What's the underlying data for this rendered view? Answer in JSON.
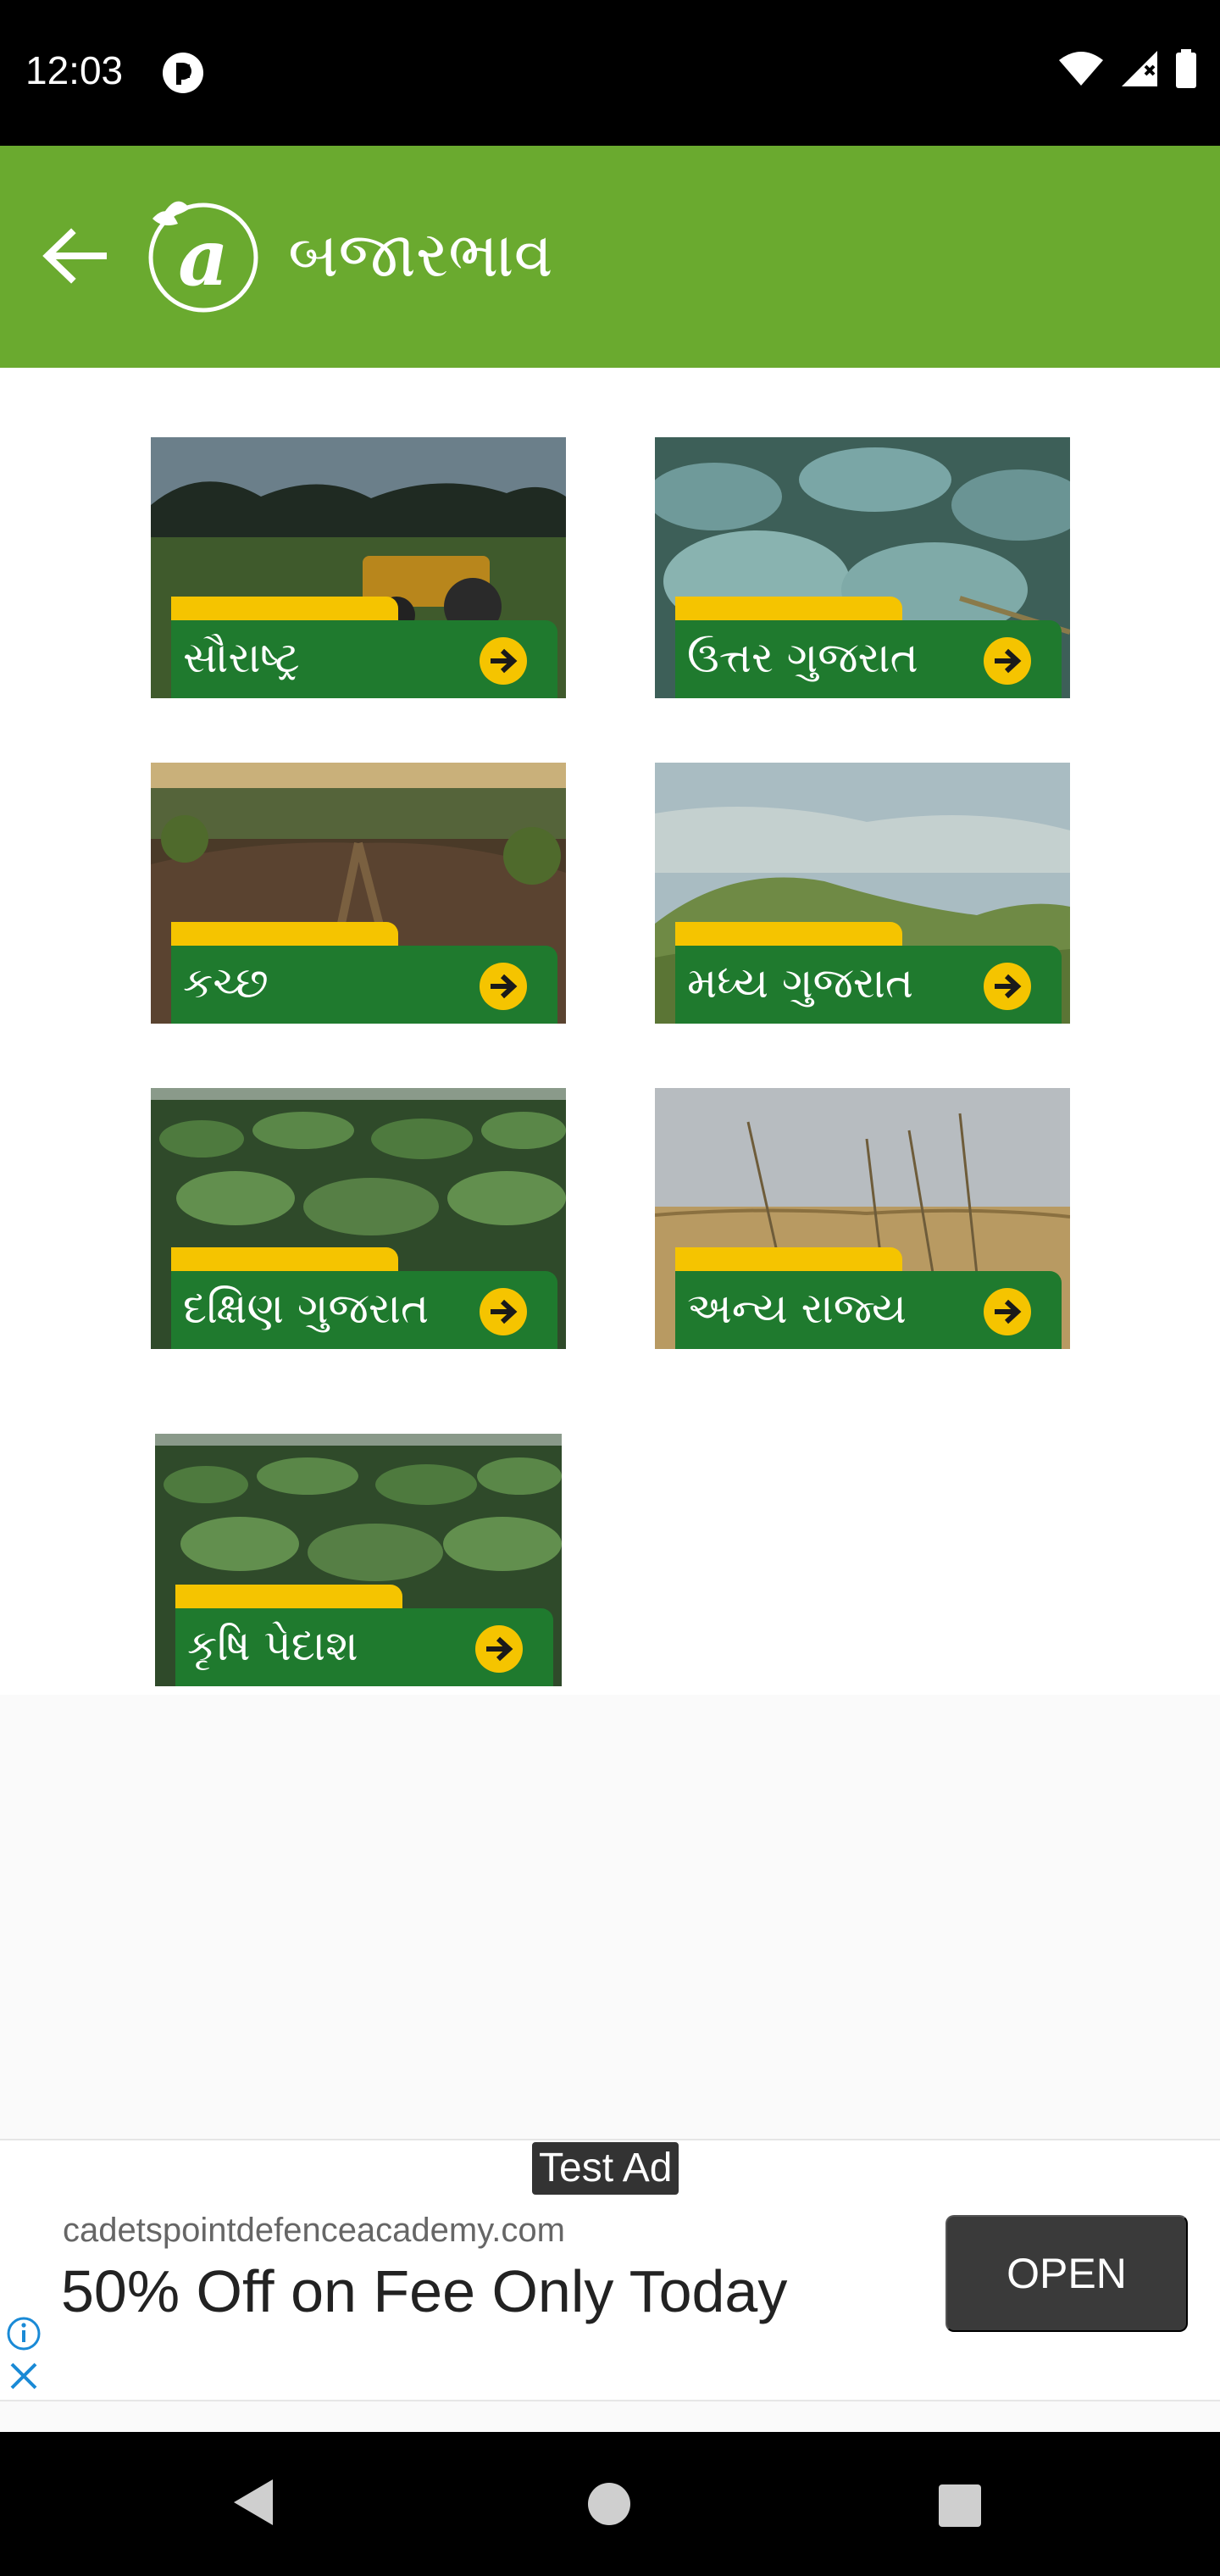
{
  "status_bar": {
    "time": "12:03"
  },
  "app_bar": {
    "title": "બજારભાવ",
    "logo_letter": "a"
  },
  "regions": [
    {
      "label": "સૌરાષ્ટ્ર",
      "photo": "tractor-field"
    },
    {
      "label": "ઉત્તર ગુજરાત",
      "photo": "cabbage-field"
    },
    {
      "label": "કચ્છ",
      "photo": "furrow-field"
    },
    {
      "label": "મધ્ય ગુજરાત",
      "photo": "green-hills"
    },
    {
      "label": "દક્ષિણ ગુજરાત",
      "photo": "leafy-crop"
    },
    {
      "label": "અન્ય રાજ્ય",
      "photo": "dry-grass"
    },
    {
      "label": "કૃષિ પેદાશ",
      "photo": "leafy-crop"
    }
  ],
  "ad": {
    "badge": "Test Ad",
    "domain": "cadetspointdefenceacademy.com",
    "headline": "50% Off on Fee Only Today",
    "cta": "OPEN"
  },
  "colors": {
    "app_bar": "#6aaa2f",
    "label_bar": "#1f7a2e",
    "accent_yellow": "#f5c400"
  }
}
